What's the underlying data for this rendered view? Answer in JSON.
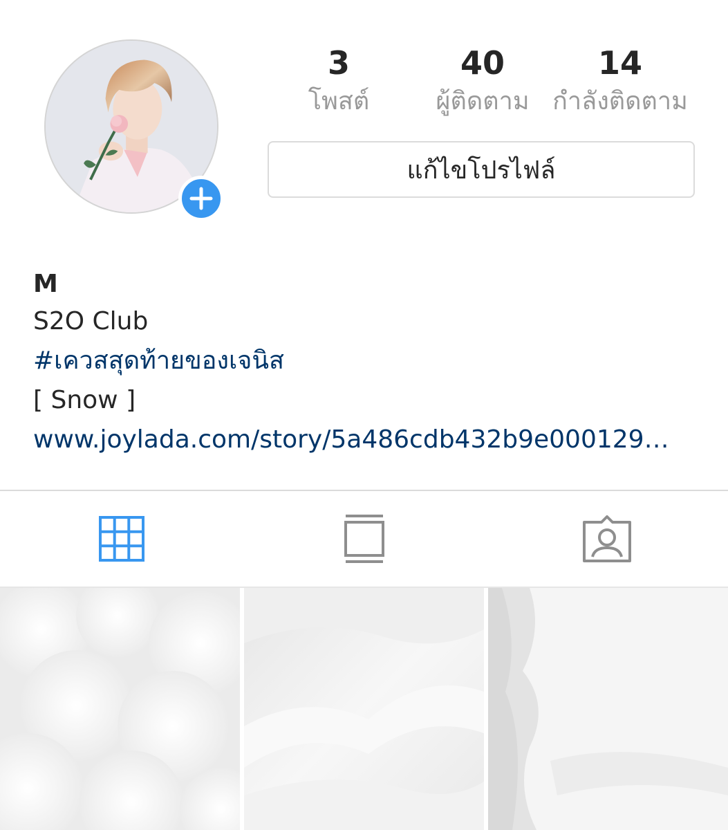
{
  "profile": {
    "stats": {
      "posts": {
        "count": "3",
        "label": "โพสต์"
      },
      "followers": {
        "count": "40",
        "label": "ผู้ติดตาม"
      },
      "following": {
        "count": "14",
        "label": "กำลังติดตาม"
      }
    },
    "edit_button_label": "แก้ไขโปรไฟล์",
    "name": "M",
    "bio": {
      "line1": "S2O Club",
      "hashtag": "#เควสสุดท้ายของเจนิส",
      "line3": "[ Snow ]",
      "link": "www.joylada.com/story/5a486cdb432b9e000129…"
    }
  },
  "tabs": [
    {
      "icon": "grid-icon",
      "active": true
    },
    {
      "icon": "feed-icon",
      "active": false
    },
    {
      "icon": "tagged-icon",
      "active": false
    }
  ],
  "colors": {
    "accent": "#3897f0",
    "link": "#003569",
    "muted_text": "#999999",
    "icon_inactive": "#8e8e8e",
    "divider": "#dbdbdb"
  }
}
